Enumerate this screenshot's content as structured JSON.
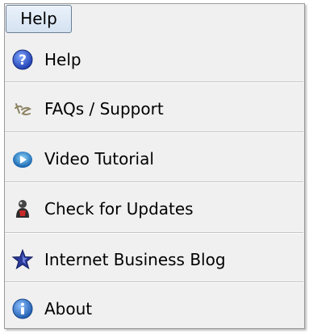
{
  "menu": {
    "title": "Help",
    "items": [
      {
        "label": "Help",
        "icon": "help-circle-icon"
      },
      {
        "label": "FAQs / Support",
        "icon": "support-signature-icon"
      },
      {
        "label": "Video Tutorial",
        "icon": "video-play-icon"
      },
      {
        "label": "Check for Updates",
        "icon": "update-figure-icon"
      },
      {
        "label": "Internet Business Blog",
        "icon": "star-icon"
      },
      {
        "label": "About",
        "icon": "info-icon"
      }
    ]
  },
  "colors": {
    "panel_background": "#f0f0f0",
    "separator": "#c5c5c5",
    "menu_button_border": "#6b7f97",
    "help_icon_blue": "#2e56c9",
    "info_icon_blue": "#2f6fc0",
    "star_blue": "#2a3a9a"
  }
}
